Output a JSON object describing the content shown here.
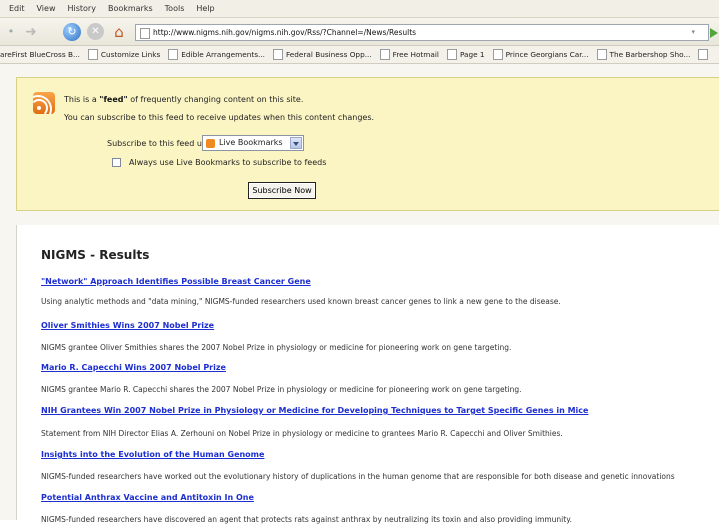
{
  "menu": [
    "Edit",
    "View",
    "History",
    "Bookmarks",
    "Tools",
    "Help"
  ],
  "toolbar": {
    "url": "http://www.nigms.nih.gov/nigms.nih.gov/Rss/?Channel=/News/Results"
  },
  "bookmarks": [
    "areFirst BlueCross B...",
    "Customize Links",
    "Edible Arrangements...",
    "Federal Business Opp...",
    "Free Hotmail",
    "Page 1",
    "Prince Georgians Car...",
    "The Barbershop Sho..."
  ],
  "feed": {
    "intro_prefix": "This is a ",
    "intro_bold": "\"feed\"",
    "intro_suffix": " of frequently changing content on this site.",
    "line2": "You can subscribe to this feed to receive updates when this content changes.",
    "subscribe_label": "Subscribe to this feed using",
    "selected_reader": "Live Bookmarks",
    "always_label": "Always use Live Bookmarks to subscribe to feeds",
    "subscribe_button": "Subscribe Now"
  },
  "results": {
    "heading": "NIGMS - Results",
    "items": [
      {
        "title": "\"Network\" Approach Identifies Possible Breast Cancer Gene",
        "desc": "Using analytic methods and \"data mining,\" NIGMS-funded researchers used known breast cancer genes to link a new gene to the disease."
      },
      {
        "title": "Oliver Smithies Wins 2007 Nobel Prize",
        "desc": "NIGMS grantee Oliver Smithies shares the 2007 Nobel Prize in physiology or medicine for pioneering work on gene targeting."
      },
      {
        "title": "Mario R. Capecchi Wins 2007 Nobel Prize",
        "desc": "NIGMS grantee Mario R. Capecchi shares the 2007 Nobel Prize in physiology or medicine for pioneering work on gene targeting."
      },
      {
        "title": "NIH Grantees Win 2007 Nobel Prize in Physiology or Medicine for Developing Techniques to Target Specific Genes in Mice",
        "desc": "Statement from NIH Director Elias A. Zerhouni on Nobel Prize in physiology or medicine to grantees Mario R. Capecchi and Oliver Smithies."
      },
      {
        "title": "Insights into the Evolution of the Human Genome",
        "desc": "NIGMS-funded researchers have worked out the evolutionary history of duplications in the human genome that are responsible for both disease and genetic innovations"
      },
      {
        "title": "Potential Anthrax Vaccine and Antitoxin In One",
        "desc": "NIGMS-funded researchers have discovered an agent that protects rats against anthrax by neutralizing its toxin and also providing immunity."
      }
    ]
  }
}
